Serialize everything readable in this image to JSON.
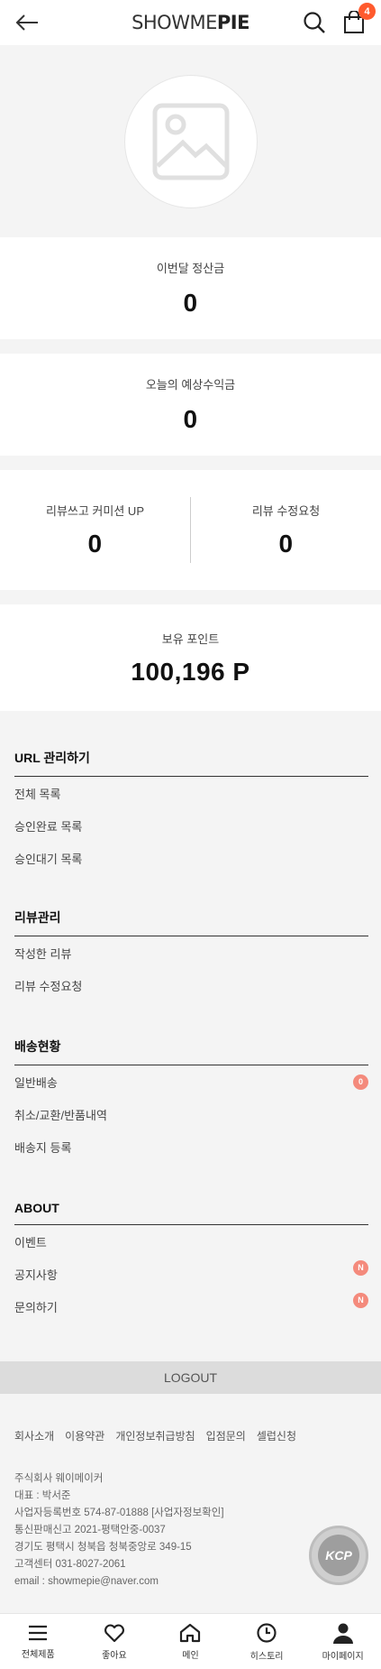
{
  "header": {
    "logo_light": "SHOWME",
    "logo_bold": "PIE",
    "cart_count": "4"
  },
  "cards": {
    "monthly_settlement": {
      "label": "이번달 정산금",
      "value": "0"
    },
    "today_expected": {
      "label": "오늘의 예상수익금",
      "value": "0"
    },
    "review_commission": {
      "label": "리뷰쓰고 커미션 UP",
      "value": "0"
    },
    "review_edit_request": {
      "label": "리뷰 수정요청",
      "value": "0"
    },
    "points": {
      "label": "보유 포인트",
      "value": "100,196 P"
    }
  },
  "menu": {
    "url": {
      "title": "URL 관리하기",
      "items": [
        "전체 목록",
        "승인완료 목록",
        "승인대기 목록"
      ]
    },
    "review": {
      "title": "리뷰관리",
      "items": [
        "작성한 리뷰",
        "리뷰 수정요청"
      ]
    },
    "delivery": {
      "title": "배송현황",
      "items": [
        "일반배송",
        "취소/교환/반품내역",
        "배송지 등록"
      ],
      "general_badge": "0"
    },
    "about": {
      "title": "ABOUT",
      "items": [
        "이벤트",
        "공지사항",
        "문의하기"
      ],
      "notice_badge": "N",
      "inquiry_badge": "N"
    }
  },
  "logout_label": "LOGOUT",
  "footer": {
    "links": [
      "회사소개",
      "이용약관",
      "개인정보취급방침",
      "입점문의",
      "셀럽신청"
    ],
    "company_lines": [
      "주식회사 웨이메이커",
      "대표 : 박서준",
      "사업자등록번호 574-87-01888 [사업자정보확인]",
      "통신판매신고 2021-평택안중-0037",
      "경기도 평택시 청북읍 청북중앙로 349-15",
      "고객센터 031-8027-2061",
      "email : showmepie@naver.com"
    ],
    "kcp_label": "KCP"
  },
  "bottom_nav": {
    "items": [
      "전체제품",
      "좋아요",
      "메인",
      "히스토리",
      "마이페이지"
    ]
  },
  "colors": {
    "accent_badge": "#ff5a2d",
    "pill_badge": "#f48a7c",
    "page_bg": "#f4f4f4"
  }
}
